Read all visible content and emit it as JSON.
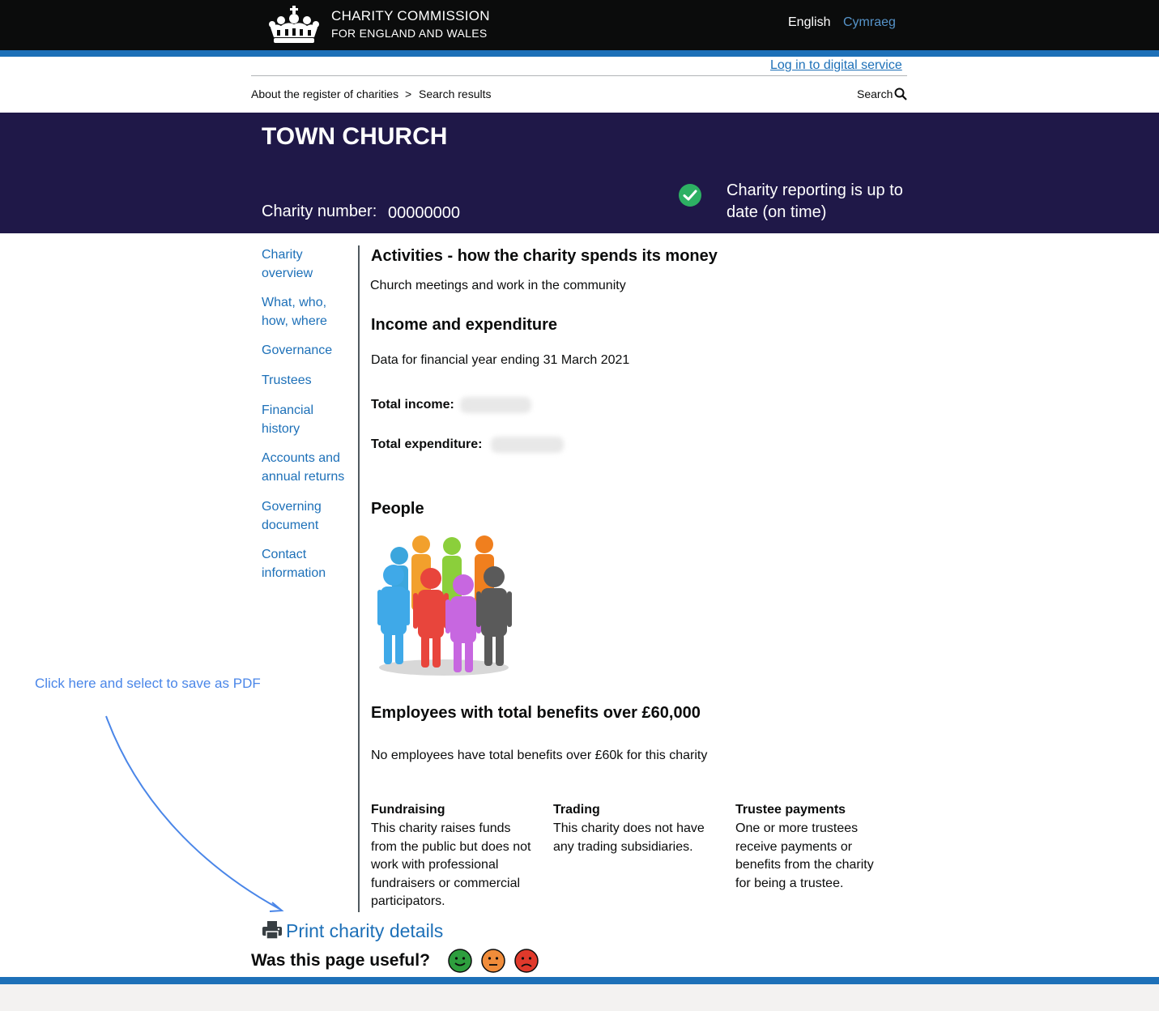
{
  "header": {
    "logo_icon": "royal-crown-icon",
    "brand_line1": "CHARITY COMMISSION",
    "brand_line2": "FOR ENGLAND AND WALES",
    "lang_english": "English",
    "lang_welsh": "Cymraeg",
    "login_link": "Log in to digital service",
    "colors": {
      "header_bg": "#0b0c0c",
      "accent_blue": "#1d70b8",
      "welsh_link": "#5694ca"
    }
  },
  "breadcrumb": {
    "item1": "About the register of charities",
    "separator": ">",
    "item2": "Search results",
    "search_label": "Search",
    "search_icon": "search-icon"
  },
  "banner": {
    "title": "TOWN CHURCH",
    "charity_number_label": "Charity number:",
    "charity_number": "00000000",
    "status_icon": "check-circle-icon",
    "status_text": "Charity reporting is up to date (on time)",
    "colors": {
      "banner_bg": "#1f1848",
      "status_green": "#2db063"
    }
  },
  "sidenav": {
    "items": [
      {
        "label": "Charity overview"
      },
      {
        "label": "What, who, how, where"
      },
      {
        "label": "Governance"
      },
      {
        "label": "Trustees"
      },
      {
        "label": "Financial history"
      },
      {
        "label": "Accounts and annual returns"
      },
      {
        "label": "Governing document"
      },
      {
        "label": "Contact information"
      }
    ]
  },
  "main": {
    "activities_heading": "Activities - how the charity spends its money",
    "activities_text": "Church meetings and work in the community",
    "income_heading": "Income and expenditure",
    "financial_year": "Data for financial year ending 31 March 2021",
    "total_income_label": "Total income:",
    "total_expenditure_label": "Total expenditure:",
    "people_heading": "People",
    "people_icon": "people-group-icon",
    "employees_heading": "Employees with total benefits over £60,000",
    "employees_text": "No employees have total benefits over £60k for this charity",
    "columns": [
      {
        "heading": "Fundraising",
        "text": "This charity raises funds from the public but does not work with professional fundraisers or commercial participators."
      },
      {
        "heading": "Trading",
        "text": "This charity does not have any trading subsidiaries."
      },
      {
        "heading": "Trustee payments",
        "text": "One or more trustees receive payments or benefits from the charity for being a trustee."
      }
    ]
  },
  "annotation": {
    "note": "Click here and select to save as PDF",
    "arrow_icon": "curved-arrow-icon",
    "color": "#4a86e8"
  },
  "footer_actions": {
    "print_icon": "printer-icon",
    "print_label": "Print charity details",
    "useful_question": "Was this page useful?",
    "faces": [
      {
        "icon": "happy-face-icon",
        "color": "#2e9e3e"
      },
      {
        "icon": "neutral-face-icon",
        "color": "#f08c3a"
      },
      {
        "icon": "sad-face-icon",
        "color": "#e0392b"
      }
    ]
  }
}
